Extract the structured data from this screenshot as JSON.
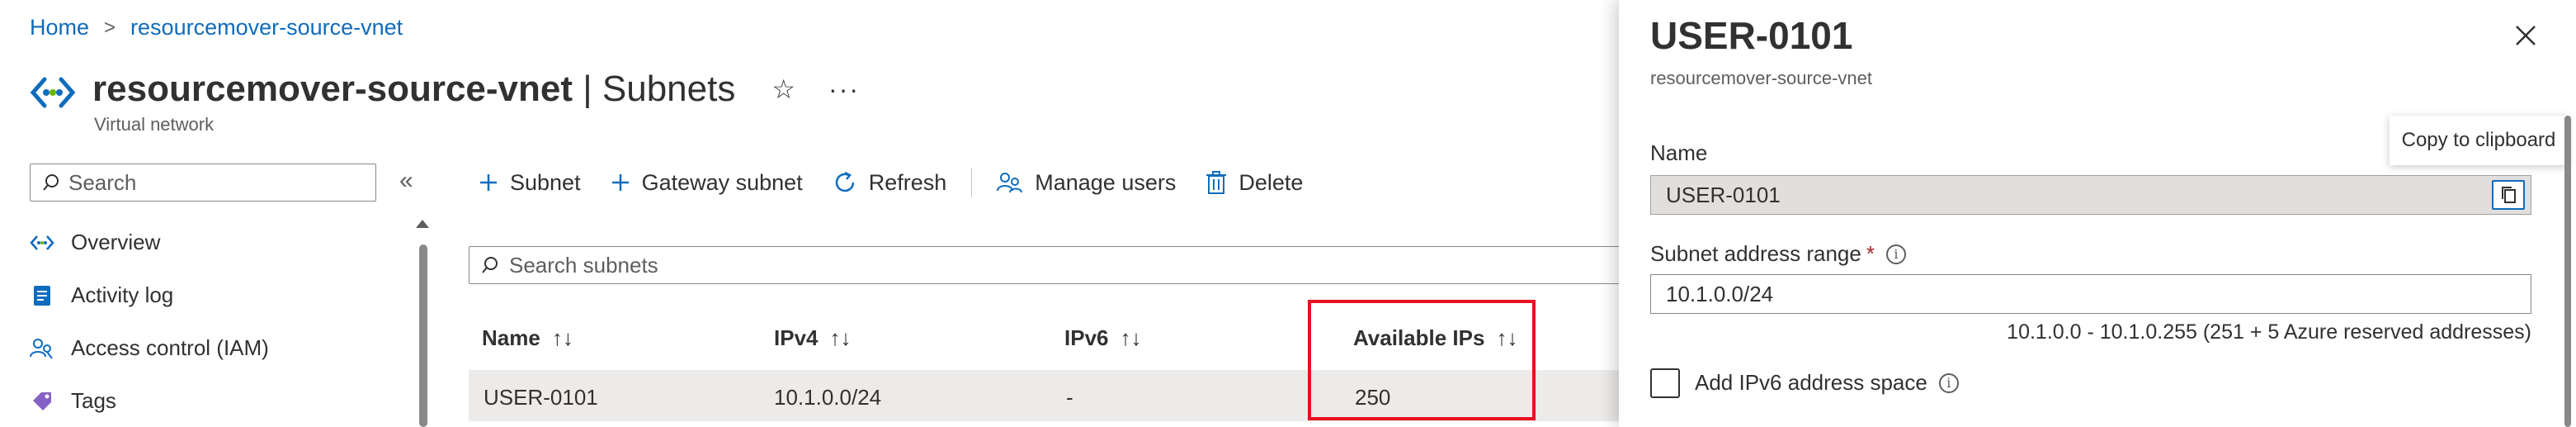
{
  "breadcrumb": {
    "home": "Home",
    "current": "resourcemover-source-vnet"
  },
  "header": {
    "title_bold": "resourcemover-source-vnet",
    "title_light": " | Subnets",
    "subtitle": "Virtual network",
    "star_icon": "☆",
    "more_icon": "···"
  },
  "sidebar": {
    "search_placeholder": "Search",
    "collapse_icon": "«",
    "items": [
      {
        "label": "Overview",
        "icon": "overview-icon"
      },
      {
        "label": "Activity log",
        "icon": "activity-log-icon"
      },
      {
        "label": "Access control (IAM)",
        "icon": "iam-icon"
      },
      {
        "label": "Tags",
        "icon": "tag-icon"
      }
    ]
  },
  "toolbar": {
    "subnet": "Subnet",
    "gateway_subnet": "Gateway subnet",
    "refresh": "Refresh",
    "manage_users": "Manage users",
    "delete": "Delete"
  },
  "subnet_search": {
    "placeholder": "Search subnets"
  },
  "table": {
    "sort_icon": "↑↓",
    "columns": [
      "Name",
      "IPv4",
      "IPv6",
      "Available IPs"
    ],
    "rows": [
      {
        "name": "USER-0101",
        "ipv4": "10.1.0.0/24",
        "ipv6": "-",
        "available": "250"
      }
    ]
  },
  "panel": {
    "title": "USER-0101",
    "subtitle": "resourcemover-source-vnet",
    "close_icon": "close-icon",
    "name_label": "Name",
    "name_value": "USER-0101",
    "copy_tooltip": "Copy to clipboard",
    "range_label": "Subnet address range",
    "required_mark": "*",
    "info_glyph": "i",
    "range_value": "10.1.0.0/24",
    "range_hint": "10.1.0.0 - 10.1.0.255 (251 + 5 Azure reserved addresses)",
    "ipv6_label": "Add IPv6 address space"
  },
  "colors": {
    "accent": "#0f6cbd",
    "highlight_border": "#e81123",
    "row_bg": "#edebe9",
    "disabled_field": "#e1dfdd"
  }
}
